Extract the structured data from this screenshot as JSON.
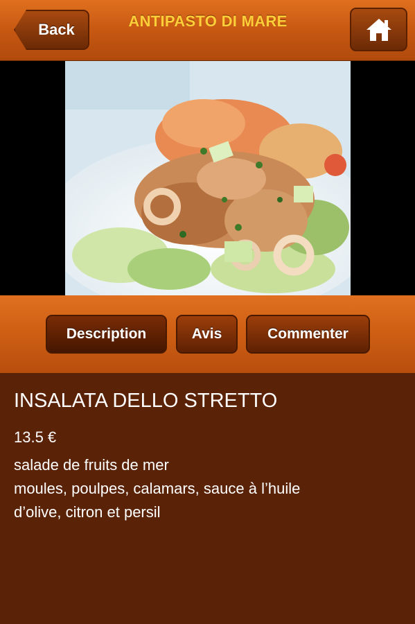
{
  "navbar": {
    "back_label": "Back",
    "title": "ANTIPASTO DI MARE",
    "home_icon": "home-icon"
  },
  "tabs": [
    {
      "label": "Description",
      "selected": true
    },
    {
      "label": "Avis",
      "selected": false
    },
    {
      "label": "Commenter",
      "selected": false
    }
  ],
  "dish": {
    "name": "INSALATA DELLO STRETTO",
    "price": "13.5 €",
    "description_lines": [
      "salade de fruits de mer",
      "moules, poulpes, calamars, sauce à l’huile",
      "d’olive, citron et persil"
    ]
  },
  "colors": {
    "accent_title": "#ffcf3a",
    "background": "#5a2206",
    "bar": "#c75812"
  }
}
